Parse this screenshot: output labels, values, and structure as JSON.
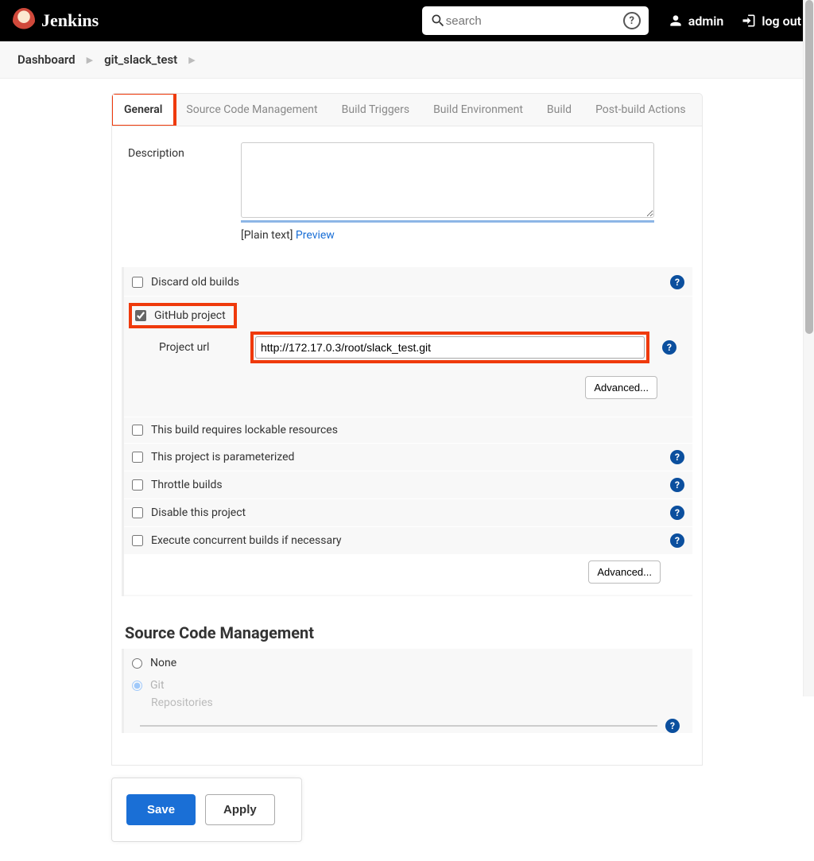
{
  "header": {
    "brand": "Jenkins",
    "search_placeholder": "search",
    "user": "admin",
    "logout": "log out"
  },
  "breadcrumb": {
    "dashboard": "Dashboard",
    "project": "git_slack_test"
  },
  "tabs": {
    "general": "General",
    "scm": "Source Code Management",
    "triggers": "Build Triggers",
    "env": "Build Environment",
    "build": "Build",
    "post": "Post-build Actions"
  },
  "form": {
    "description_label": "Description",
    "plaintext": "[Plain text]",
    "preview": "Preview",
    "discard": "Discard old builds",
    "github_project": "GitHub project",
    "project_url_label": "Project url",
    "project_url_value": "http://172.17.0.3/root/slack_test.git",
    "advanced": "Advanced...",
    "lockable": "This build requires lockable resources",
    "parameterized": "This project is parameterized",
    "throttle": "Throttle builds",
    "disable": "Disable this project",
    "concurrent": "Execute concurrent builds if necessary"
  },
  "scm": {
    "heading": "Source Code Management",
    "none": "None",
    "git": "Git",
    "repositories": "Repositories"
  },
  "buttons": {
    "save": "Save",
    "apply": "Apply"
  },
  "help_glyph": "?"
}
